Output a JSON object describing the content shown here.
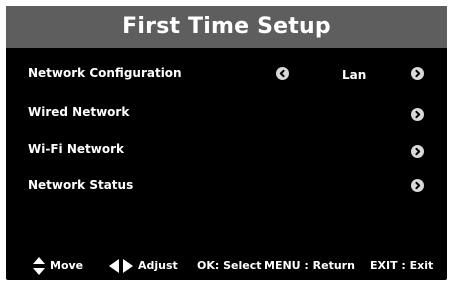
{
  "title": "First Time Setup",
  "menu": {
    "network_configuration": {
      "label": "Network Configuration",
      "value": "Lan"
    },
    "wired_network": {
      "label": "Wired Network"
    },
    "wifi_network": {
      "label": "Wi-Fi Network"
    },
    "network_status": {
      "label": "Network Status"
    }
  },
  "footer": {
    "move": "Move",
    "adjust": "Adjust",
    "ok": "OK: Select",
    "menu": "MENU : Return",
    "exit": "EXIT : Exit"
  },
  "icons": {
    "arrow_left": "arrow-left-icon",
    "arrow_right": "arrow-right-icon",
    "up_down": "up-down-arrows-icon",
    "left_right": "left-right-arrows-icon"
  },
  "colors": {
    "titlebar": "#5e5e5e",
    "background": "#000000",
    "text": "#ffffff",
    "button": "#d8d8d8"
  }
}
